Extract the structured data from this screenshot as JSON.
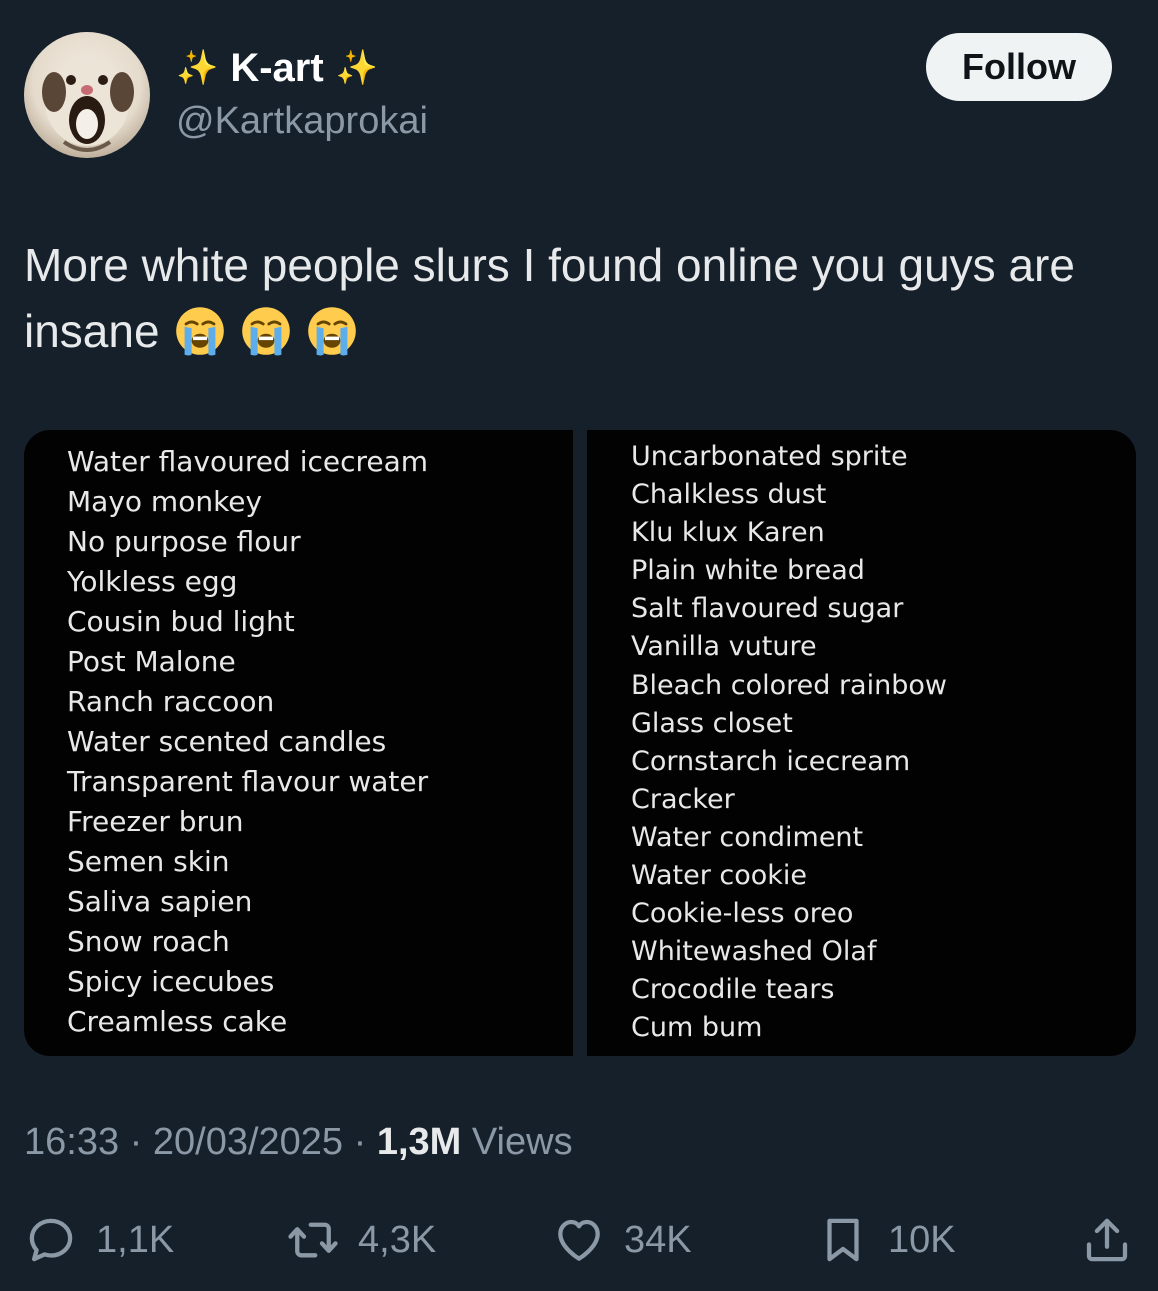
{
  "user": {
    "display_name": "K-art",
    "sparkle_left": "✨",
    "sparkle_right": "✨",
    "handle": "@Kartkaprokai",
    "follow_label": "Follow"
  },
  "tweet": {
    "text": "More white people slurs I found online you guys are insane",
    "emojis": [
      "loudly-crying-face",
      "loudly-crying-face",
      "loudly-crying-face"
    ]
  },
  "media": {
    "left_list": [
      "Water flavoured icecream",
      "Mayo monkey",
      "No purpose flour",
      "Yolkless egg",
      "Cousin bud light",
      "Post Malone",
      "Ranch raccoon",
      "Water scented candles",
      "Transparent flavour water",
      "Freezer brun",
      "Semen skin",
      "Saliva sapien",
      "Snow roach",
      "Spicy icecubes",
      "Creamless cake"
    ],
    "right_list": [
      "Uncarbonated sprite",
      "Chalkless dust",
      "Klu klux Karen",
      "Plain white bread",
      "Salt flavoured sugar",
      "Vanilla vuture",
      "Bleach colored rainbow",
      "Glass closet",
      "Cornstarch icecream",
      "Cracker",
      "Water condiment",
      "Water cookie",
      "Cookie-less oreo",
      "Whitewashed Olaf",
      "Crocodile tears",
      "Cum bum"
    ]
  },
  "meta": {
    "time": "16:33",
    "sep1": " · ",
    "date": "20/03/2025",
    "sep2": " · ",
    "views_count": "1,3M",
    "views_label": " Views"
  },
  "actions": {
    "replies": "1,1K",
    "reposts": "4,3K",
    "likes": "34K",
    "bookmarks": "10K"
  },
  "colors": {
    "background": "#15202b",
    "text": "#e7e9ea",
    "secondary": "#8b98a5",
    "follow_bg": "#eff3f4",
    "media_bg": "#020202"
  }
}
